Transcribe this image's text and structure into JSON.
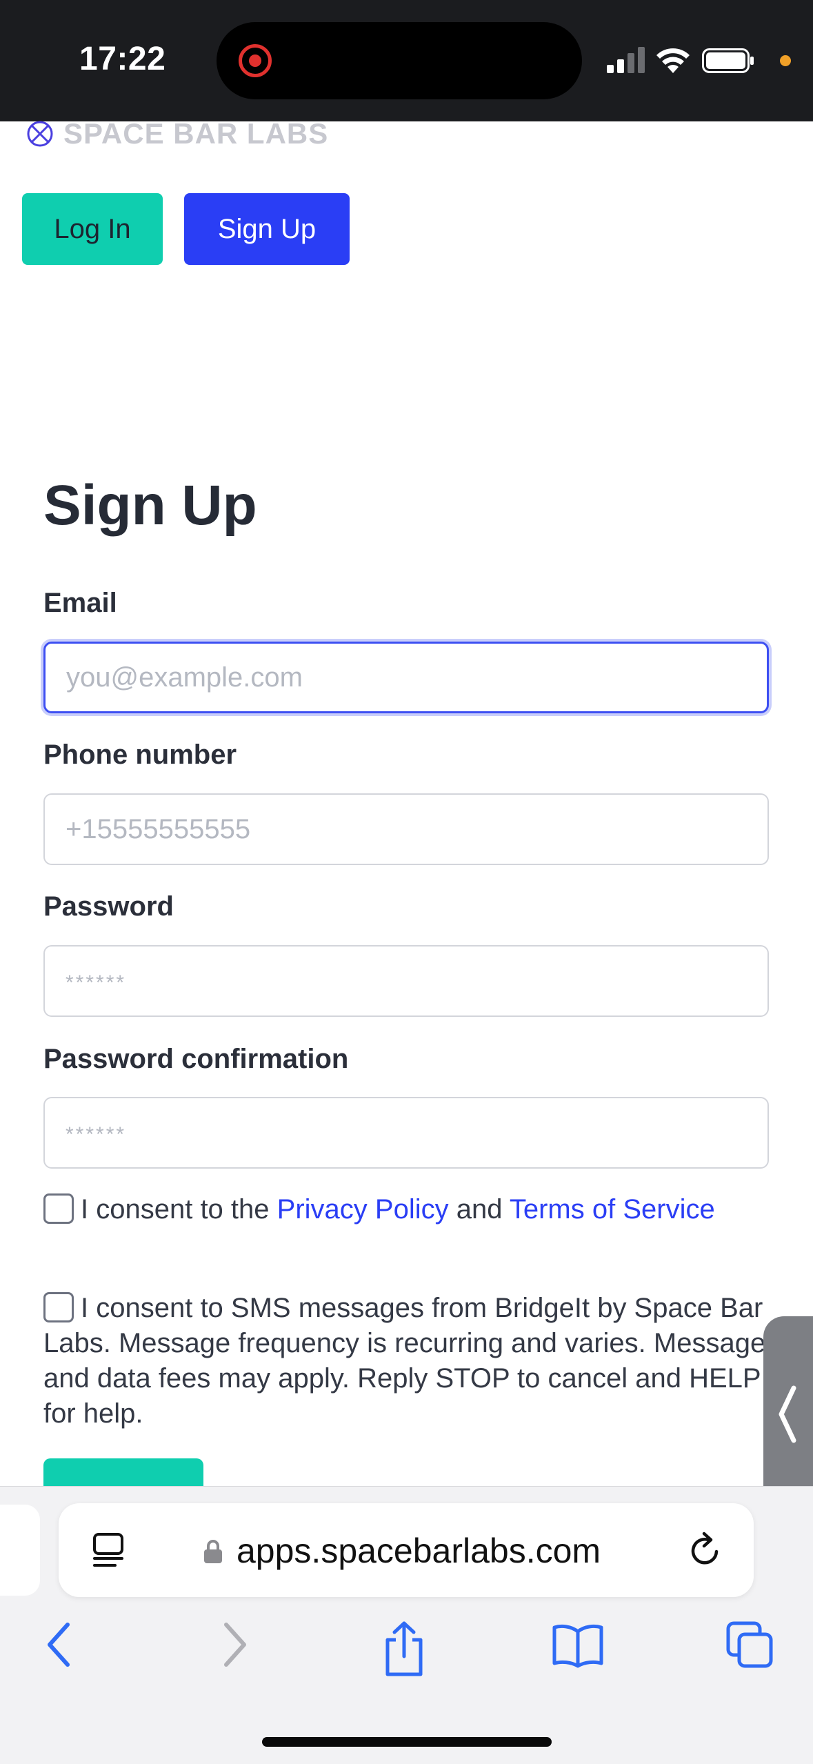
{
  "status_bar": {
    "time": "17:22",
    "icons": [
      "screen-recording-icon",
      "cellular-signal-icon",
      "wifi-icon",
      "battery-icon",
      "privacy-indicator-dot"
    ]
  },
  "brand": {
    "name": "SPACE BAR LABS",
    "logo": "space-bar-labs-logo-icon"
  },
  "nav": {
    "login_label": "Log In",
    "signup_label": "Sign Up"
  },
  "form": {
    "title": "Sign Up",
    "email": {
      "label": "Email",
      "placeholder": "you@example.com",
      "value": ""
    },
    "phone": {
      "label": "Phone number",
      "placeholder": "+15555555555",
      "value": ""
    },
    "password": {
      "label": "Password",
      "placeholder": "******",
      "value": ""
    },
    "password_confirmation": {
      "label": "Password confirmation",
      "placeholder": "******",
      "value": ""
    },
    "consent_terms": {
      "checked": false,
      "prefix": "I consent to the ",
      "privacy_link": "Privacy Policy",
      "middle": " and ",
      "terms_link": "Terms of Service"
    },
    "consent_sms": {
      "checked": false,
      "text": "I consent to SMS messages from BridgeIt by Space Bar Labs. Message frequency is recurring and varies. Message and data fees may apply. Reply STOP to cancel and HELP for help."
    }
  },
  "browser": {
    "url": "apps.spacebarlabs.com",
    "toolbar": [
      "back-icon",
      "forward-icon",
      "share-icon",
      "bookmarks-icon",
      "tabs-icon"
    ]
  },
  "colors": {
    "login_button": "#0fceaf",
    "signup_button": "#2a3ef5",
    "link": "#2a3ef5",
    "focus_border": "#3d4ff2",
    "status_bar": "#1b1c1f"
  }
}
